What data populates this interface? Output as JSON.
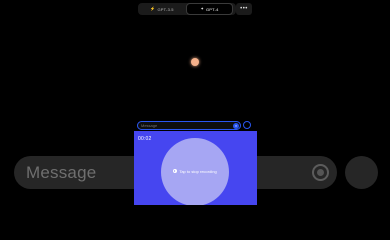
{
  "header": {
    "models": [
      {
        "label": "GPT-3.5",
        "icon": "lightning-icon"
      },
      {
        "label": "GPT-4",
        "icon": "sparkle-icon",
        "selected": true
      }
    ],
    "more_label": "•••"
  },
  "composer": {
    "placeholder": "Message",
    "inner_placeholder": "Message"
  },
  "recording": {
    "timer": "00:02",
    "label": "Tap to stop recording"
  },
  "colors": {
    "accent": "#4646f0",
    "orb": "#f5b08a",
    "recording_circle": "#a6a6f3",
    "input_border": "#2a56f0"
  }
}
